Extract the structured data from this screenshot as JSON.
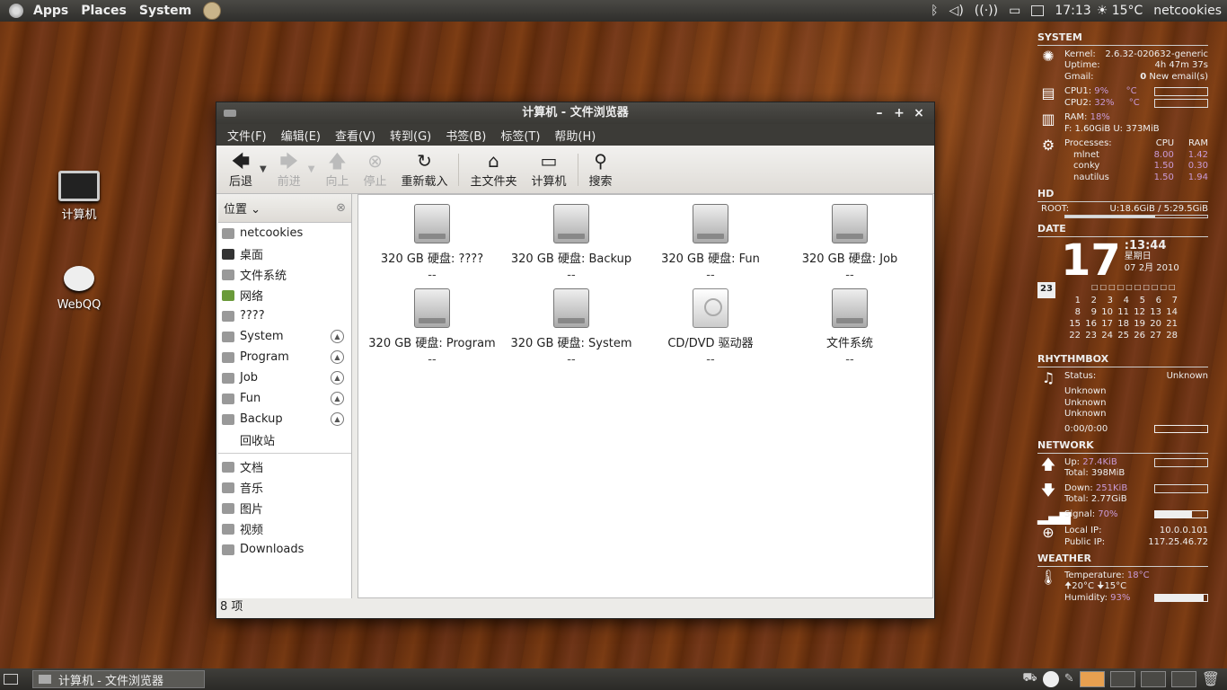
{
  "top_panel": {
    "menus": [
      "Apps",
      "Places",
      "System"
    ],
    "time": "17:13",
    "weather": "☀ 15°C",
    "user": "netcookies"
  },
  "desktop_icons": [
    {
      "label": "计算机"
    },
    {
      "label": "WebQQ"
    }
  ],
  "window": {
    "title": "计算机 - 文件浏览器",
    "controls": [
      "–",
      "+",
      "×"
    ],
    "menubar": [
      "文件(F)",
      "编辑(E)",
      "查看(V)",
      "转到(G)",
      "书签(B)",
      "标签(T)",
      "帮助(H)"
    ],
    "toolbar": {
      "back": "后退",
      "forward": "前进",
      "up": "向上",
      "stop": "停止",
      "reload": "重新载入",
      "home": "主文件夹",
      "computer": "计算机",
      "search": "搜索"
    },
    "sidebar": {
      "header": "位置",
      "items": [
        "netcookies",
        "桌面",
        "文件系统",
        "网络",
        "????",
        "System",
        "Program",
        "Job",
        "Fun",
        "Backup",
        "回收站"
      ],
      "bookmarks": [
        "文档",
        "音乐",
        "图片",
        "视频",
        "Downloads"
      ]
    },
    "items": [
      {
        "label": "320 GB 硬盘: ????",
        "sub": "--",
        "kind": "hdd"
      },
      {
        "label": "320 GB 硬盘: Backup",
        "sub": "--",
        "kind": "hdd"
      },
      {
        "label": "320 GB 硬盘: Fun",
        "sub": "--",
        "kind": "hdd"
      },
      {
        "label": "320 GB 硬盘: Job",
        "sub": "--",
        "kind": "hdd"
      },
      {
        "label": "320 GB 硬盘: Program",
        "sub": "--",
        "kind": "hdd"
      },
      {
        "label": "320 GB 硬盘: System",
        "sub": "--",
        "kind": "hdd"
      },
      {
        "label": "CD/DVD 驱动器",
        "sub": "--",
        "kind": "cd"
      },
      {
        "label": "文件系统",
        "sub": "--",
        "kind": "hdd"
      }
    ],
    "status": "8 项"
  },
  "conky": {
    "system": {
      "header": "SYSTEM",
      "kernel_label": "Kernel:",
      "kernel": "2.6.32-020632-generic",
      "uptime_label": "Uptime:",
      "uptime": "4h 47m 37s",
      "gmail_label": "Gmail:",
      "gmail_count": "0",
      "gmail_text": "New email(s)",
      "cpu1_label": "CPU1:",
      "cpu1": "9%",
      "cpu2_label": "CPU2:",
      "cpu2": "32%",
      "temp_unit": "°C",
      "ram_label": "RAM:",
      "ram": "18%",
      "ram_detail": "F: 1.60GiB U: 373MiB",
      "proc_label": "Processes:",
      "proc_cpu": "CPU",
      "proc_ram": "RAM",
      "processes": [
        {
          "name": "mlnet",
          "cpu": "8.00",
          "ram": "1.42"
        },
        {
          "name": "conky",
          "cpu": "1.50",
          "ram": "0.30"
        },
        {
          "name": "nautilus",
          "cpu": "1.50",
          "ram": "1.94"
        }
      ]
    },
    "hd": {
      "header": "HD",
      "root_label": "ROOT:",
      "root": "U:18.6GiB / 5:29.5GiB",
      "used_fraction": 0.63
    },
    "date": {
      "header": "DATE",
      "day": "17",
      "time": ":13:44",
      "weekday": "星期日",
      "date": "07 2月 2010",
      "icon_day": "23",
      "weekday_row": "□□□□□□□□□□",
      "calendar": [
        [
          "1",
          "2",
          "3",
          "4",
          "5",
          "6",
          "7"
        ],
        [
          "8",
          "9",
          "10",
          "11",
          "12",
          "13",
          "14"
        ],
        [
          "15",
          "16",
          "17",
          "18",
          "19",
          "20",
          "21"
        ],
        [
          "22",
          "23",
          "24",
          "25",
          "26",
          "27",
          "28"
        ]
      ]
    },
    "rhythmbox": {
      "header": "RHYTHMBOX",
      "status_label": "Status:",
      "status": "Unknown",
      "lines": [
        "Unknown",
        "Unknown",
        "Unknown"
      ],
      "time": "0:00/0:00",
      "progress": 0
    },
    "network": {
      "header": "NETWORK",
      "up_label": "Up:",
      "up": "27.4KiB",
      "up_total": "Total: 398MiB",
      "down_label": "Down:",
      "down": "251KiB",
      "down_total": "Total: 2.77GiB",
      "signal_label": "Signal:",
      "signal": "70%",
      "signal_fraction": 0.7,
      "local_label": "Local IP:",
      "local_ip": "10.0.0.101",
      "public_label": "Public IP:",
      "public_ip": "117.25.46.72"
    },
    "weather": {
      "header": "WEATHER",
      "temp_label": "Temperature:",
      "temp": "18°C",
      "range": "🠉20°C 🠋15°C",
      "humidity_label": "Humidity:",
      "humidity": "93%",
      "humidity_fraction": 0.93
    }
  },
  "bottom_panel": {
    "task": "计算机 - 文件浏览器"
  }
}
